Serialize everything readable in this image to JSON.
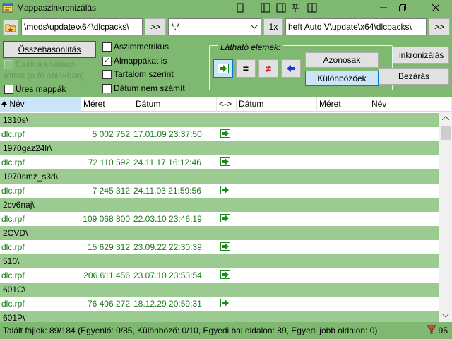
{
  "window": {
    "title": "Mappaszinkronizálás",
    "colors": {
      "background": "#7fb870",
      "dir_row": "#9ccb92",
      "file_text": "#1a7a1a",
      "arrow": "#1a8a1a"
    }
  },
  "toolbar": {
    "left_path": "\\mods\\update\\x64\\dlcpacks\\",
    "browse_left": ">>",
    "mask": "*.*",
    "mask_button": "1x",
    "right_path": "heft Auto V\\update\\x64\\dlcpacks\\",
    "browse_right": ">>"
  },
  "panel": {
    "compare_button": "Összehasonlítás",
    "only_selected_line1": "Csak a kiválasz-",
    "only_selected_line2": "tottak (a fő ablakban)",
    "empty_dirs": "Üres mappák",
    "asymmetric": "Aszimmetrikus",
    "subdirs": "Almappákat is",
    "by_content": "Tartalom szerint",
    "ignore_date": "Dátum nem számít",
    "visible_label": "Látható elemek:",
    "identical_button": "Azonosak",
    "different_button": "Különbözőek",
    "sync_button": "inkronizálás",
    "close_button": "Bezárás",
    "checked": {
      "subdirs": true,
      "asymmetric": false,
      "by_content": false,
      "ignore_date": false,
      "empty_dirs": false,
      "only_selected": false
    }
  },
  "columns": {
    "left_name": "Név",
    "left_size": "Méret",
    "left_date": "Dátum",
    "compare": "<->",
    "right_date": "Dátum",
    "right_size": "Méret",
    "right_name": "Név"
  },
  "rows": [
    {
      "type": "dir",
      "name": "1310s\\"
    },
    {
      "type": "file",
      "name": "dlc.rpf",
      "size": "5 002 752",
      "date": "17.01.09 23:37:50"
    },
    {
      "type": "dir",
      "name": "1970gaz24lr\\"
    },
    {
      "type": "file",
      "name": "dlc.rpf",
      "size": "72 110 592",
      "date": "24.11.17 16:12:46"
    },
    {
      "type": "dir",
      "name": "1970smz_s3d\\"
    },
    {
      "type": "file",
      "name": "dlc.rpf",
      "size": "7 245 312",
      "date": "24.11.03 21:59:56"
    },
    {
      "type": "dir",
      "name": "2cv6naj\\"
    },
    {
      "type": "file",
      "name": "dlc.rpf",
      "size": "109 068 800",
      "date": "22.03.10 23:46:19"
    },
    {
      "type": "dir",
      "name": "2CVD\\"
    },
    {
      "type": "file",
      "name": "dlc.rpf",
      "size": "15 629 312",
      "date": "23.09.22 22:30:39"
    },
    {
      "type": "dir",
      "name": "510\\"
    },
    {
      "type": "file",
      "name": "dlc.rpf",
      "size": "206 611 456",
      "date": "23.07.10 23:53:54"
    },
    {
      "type": "dir",
      "name": "601C\\"
    },
    {
      "type": "file",
      "name": "dlc.rpf",
      "size": "76 406 272",
      "date": "18.12.29 20:59:31"
    },
    {
      "type": "dir",
      "name": "601P\\"
    }
  ],
  "status": {
    "text": "Talált fájlok: 89/184  (Egyenlő: 0/85, Különböző: 0/10, Egyedi bal oldalon: 89, Egyedi jobb oldalon: 0)",
    "count": "95"
  }
}
